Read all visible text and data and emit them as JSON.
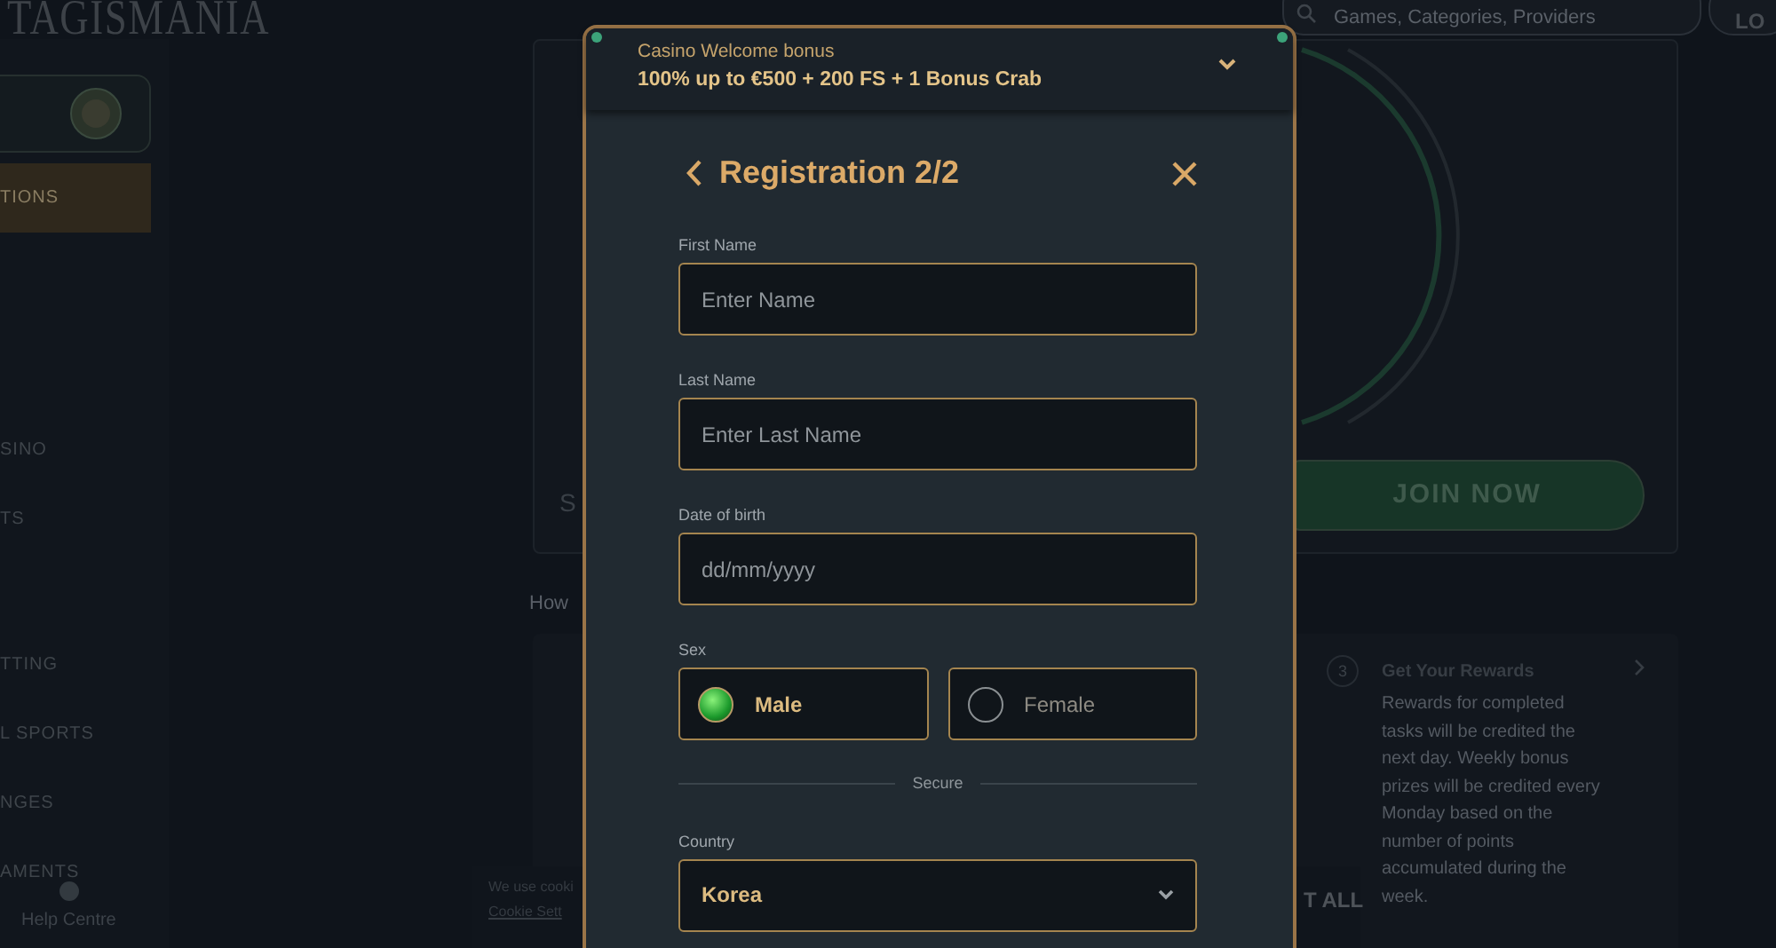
{
  "header": {
    "logo": "TAGISMANIA",
    "search": {
      "placeholder": "Games, Categories, Providers"
    },
    "login_button": "LO"
  },
  "sidebar": {
    "items": [
      {
        "label": "TIONS",
        "selected": true
      },
      {
        "label": "SINO",
        "selected": false
      },
      {
        "label": "TS",
        "selected": false
      },
      {
        "label": "TTING",
        "selected": false
      },
      {
        "label": "L SPORTS",
        "selected": false
      },
      {
        "label": "NGES",
        "selected": false
      },
      {
        "label": "AMENTS",
        "selected": false
      }
    ],
    "help": "Help Centre"
  },
  "banner": {
    "text": "S",
    "button": "JOIN NOW"
  },
  "how_heading": "How",
  "steps": [
    {
      "number": "3",
      "title": "Get Your Rewards",
      "text": "Rewards for completed tasks will be credited the next day. Weekly bonus prizes will be credited every Monday based on the number of points accumulated during the week."
    }
  ],
  "cookie_bar": {
    "text": "We use cooki",
    "link": "Cookie Sett",
    "button": "T ALL"
  },
  "modal": {
    "bonus": {
      "label": "Casino Welcome bonus",
      "offer": "100% up to €500 + 200 FS + 1 Bonus Crab"
    },
    "title": "Registration 2/2",
    "fields": [
      {
        "kind": "text",
        "label": "First Name",
        "placeholder": "Enter Name"
      },
      {
        "kind": "text",
        "label": "Last Name",
        "placeholder": "Enter Last Name"
      },
      {
        "kind": "text",
        "label": "Date of birth",
        "placeholder": "dd/mm/yyyy"
      },
      {
        "kind": "radio",
        "label": "Sex",
        "options": [
          {
            "label": "Male",
            "selected": true
          },
          {
            "label": "Female",
            "selected": false
          }
        ]
      },
      {
        "kind": "divider",
        "label": "Secure"
      },
      {
        "kind": "select",
        "label": "Country",
        "value": "Korea"
      }
    ]
  }
}
